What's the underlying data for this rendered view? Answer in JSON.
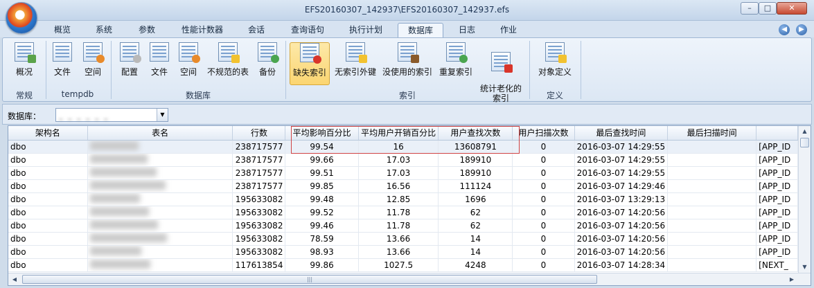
{
  "window": {
    "title": "EFS20160307_142937\\EFS20160307_142937.efs",
    "controls": {
      "minimize": "–",
      "maximize": "□",
      "close": "✕"
    }
  },
  "tabs": [
    {
      "label": "概览",
      "active": false
    },
    {
      "label": "系统",
      "active": false
    },
    {
      "label": "参数",
      "active": false
    },
    {
      "label": "性能计数器",
      "active": false
    },
    {
      "label": "会话",
      "active": false
    },
    {
      "label": "查询语句",
      "active": false
    },
    {
      "label": "执行计划",
      "active": false
    },
    {
      "label": "数据库",
      "active": true
    },
    {
      "label": "日志",
      "active": false
    },
    {
      "label": "作业",
      "active": false
    }
  ],
  "nav": {
    "back": "◀",
    "forward": "▶"
  },
  "ribbon": {
    "groups": [
      {
        "label": "常规",
        "buttons": [
          {
            "label": "概况",
            "icon": "overview-icon"
          }
        ]
      },
      {
        "label": "tempdb",
        "buttons": [
          {
            "label": "文件",
            "icon": "file-icon"
          },
          {
            "label": "空间",
            "icon": "space-icon"
          }
        ]
      },
      {
        "label": "数据库",
        "buttons": [
          {
            "label": "配置",
            "icon": "config-icon"
          },
          {
            "label": "文件",
            "icon": "file-icon"
          },
          {
            "label": "空间",
            "icon": "space-icon"
          },
          {
            "label": "不规范的表",
            "icon": "warning-table-icon"
          },
          {
            "label": "备份",
            "icon": "backup-icon"
          }
        ]
      },
      {
        "label": "索引",
        "buttons": [
          {
            "label": "缺失索引",
            "icon": "missing-index-icon",
            "active": true
          },
          {
            "label": "无索引外键",
            "icon": "fk-no-index-icon"
          },
          {
            "label": "没使用的索引",
            "icon": "unused-index-icon"
          },
          {
            "label": "重复索引",
            "icon": "duplicate-index-icon"
          },
          {
            "label": "统计老化的\n索引",
            "icon": "stats-chart-icon"
          }
        ]
      },
      {
        "label": "定义",
        "buttons": [
          {
            "label": "对象定义",
            "icon": "object-def-icon"
          }
        ]
      }
    ]
  },
  "db_selector": {
    "label": "数据库：",
    "value": "_ _ _ _ _ _"
  },
  "grid": {
    "columns": [
      "架构名",
      "表名",
      "行数",
      "平均影响百分比",
      "平均用户开销百分比",
      "用户查找次数",
      "用户扫描次数",
      "最后查找时间",
      "最后扫描时间",
      ""
    ],
    "rows": [
      [
        "dbo",
        "",
        "238717577",
        "99.54",
        "16",
        "13608791",
        "0",
        "2016-03-07 14:29:55",
        "",
        "[APP_ID"
      ],
      [
        "dbo",
        "",
        "238717577",
        "99.66",
        "17.03",
        "189910",
        "0",
        "2016-03-07 14:29:55",
        "",
        "[APP_ID"
      ],
      [
        "dbo",
        "",
        "238717577",
        "99.51",
        "17.03",
        "189910",
        "0",
        "2016-03-07 14:29:55",
        "",
        "[APP_ID"
      ],
      [
        "dbo",
        "",
        "238717577",
        "99.85",
        "16.56",
        "111124",
        "0",
        "2016-03-07 14:29:46",
        "",
        "[APP_ID"
      ],
      [
        "dbo",
        "",
        "195633082",
        "99.48",
        "12.85",
        "1696",
        "0",
        "2016-03-07 13:29:13",
        "",
        "[APP_ID"
      ],
      [
        "dbo",
        "",
        "195633082",
        "99.52",
        "11.78",
        "62",
        "0",
        "2016-03-07 14:20:56",
        "",
        "[APP_ID"
      ],
      [
        "dbo",
        "",
        "195633082",
        "99.46",
        "11.78",
        "62",
        "0",
        "2016-03-07 14:20:56",
        "",
        "[APP_ID"
      ],
      [
        "dbo",
        "",
        "195633082",
        "78.59",
        "13.66",
        "14",
        "0",
        "2016-03-07 14:20:56",
        "",
        "[APP_ID"
      ],
      [
        "dbo",
        "",
        "195633082",
        "98.93",
        "13.66",
        "14",
        "0",
        "2016-03-07 14:20:56",
        "",
        "[APP_ID"
      ],
      [
        "dbo",
        "",
        "117613854",
        "99.86",
        "1027.5",
        "4248",
        "0",
        "2016-03-07 14:28:34",
        "",
        "[NEXT_"
      ]
    ]
  },
  "colors": {
    "accent_tab": "#f1f6fc",
    "active_button": "#fbd571",
    "highlight_box": "#d04343"
  }
}
